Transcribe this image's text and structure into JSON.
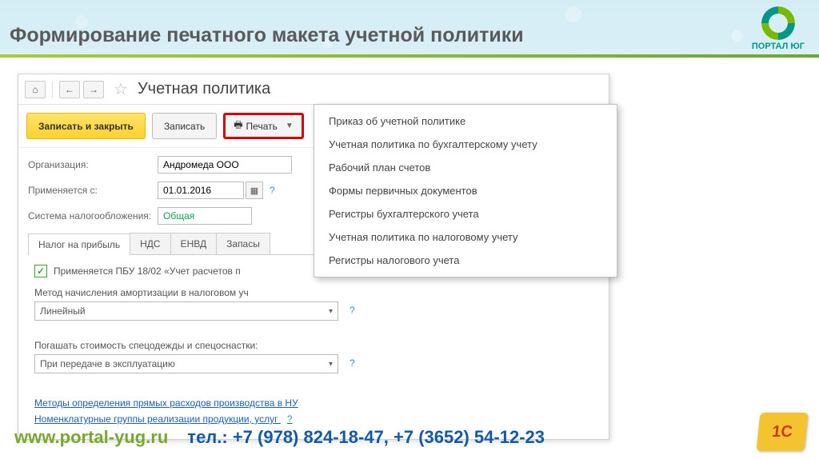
{
  "slide": {
    "title": "Формирование печатного макета учетной политики",
    "logo_text": "ПОРТАЛ ЮГ"
  },
  "nav": {
    "home": "⌂",
    "back": "←",
    "forward": "→",
    "star": "☆"
  },
  "form": {
    "title": "Учетная политика"
  },
  "toolbar": {
    "save_close": "Записать и закрыть",
    "save": "Записать",
    "print": "Печать"
  },
  "fields": {
    "org_label": "Организация:",
    "org_value": "Андромеда ООО",
    "date_label": "Применяется с:",
    "date_value": "01.01.2016",
    "tax_label": "Система налогообложения:",
    "tax_value": "Общая"
  },
  "tabs": [
    "Налог на прибыль",
    "НДС",
    "ЕНВД",
    "Запасы"
  ],
  "panel": {
    "chk_label": "Применяется ПБУ 18/02 «Учет расчетов п",
    "amort_label": "Метод начисления амортизации в налоговом уч",
    "amort_value": "Линейный",
    "spec_label": "Погашать стоимость спецодежды и спецоснастки:",
    "spec_value": "При передаче в эксплуатацию",
    "link1": "Методы определения прямых расходов производства в НУ",
    "link2": "Номенклатурные группы реализации продукции, услуг"
  },
  "dropdown": {
    "items": [
      "Приказ об учетной политике",
      "Учетная политика по бухгалтерскому учету",
      "Рабочий план счетов",
      "Формы первичных документов",
      "Регистры бухгалтерского учета",
      "Учетная политика по налоговому учету",
      "Регистры налогового учета"
    ]
  },
  "footer": {
    "url": "www.portal-yug.ru",
    "tel": "тел.: +7 (978) 824-18-47, +7 (3652) 54-12-23",
    "logo_1c": "1С"
  }
}
